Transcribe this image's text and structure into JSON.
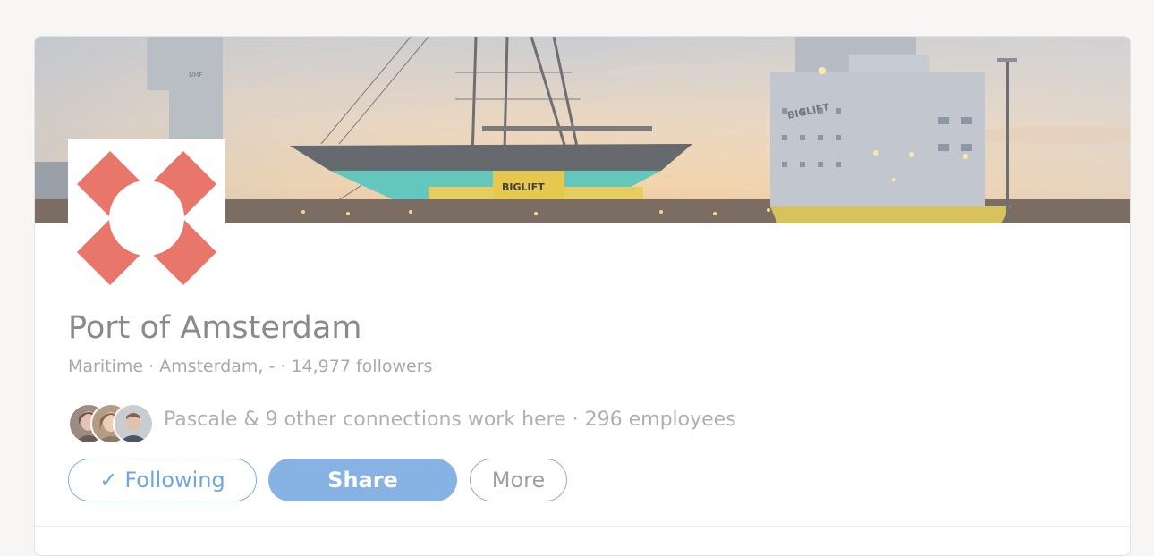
{
  "company": {
    "name": "Port of Amsterdam",
    "subline": "Maritime · Amsterdam, - · 14,977 followers",
    "connections_text": "Pascale & 9 other connections work here · 296 employees"
  },
  "cover": {
    "ship_label_1": "BIGLIFT",
    "ship_label_2": "BIGLIFT",
    "crane_label": "NMF"
  },
  "actions": {
    "following_check": "✓",
    "following_label": "Following",
    "share_label": "Share",
    "more_label": "More"
  },
  "colors": {
    "accent": "#6fa6dd",
    "share_bg": "#86b3e3",
    "logo": "#e8766a"
  }
}
